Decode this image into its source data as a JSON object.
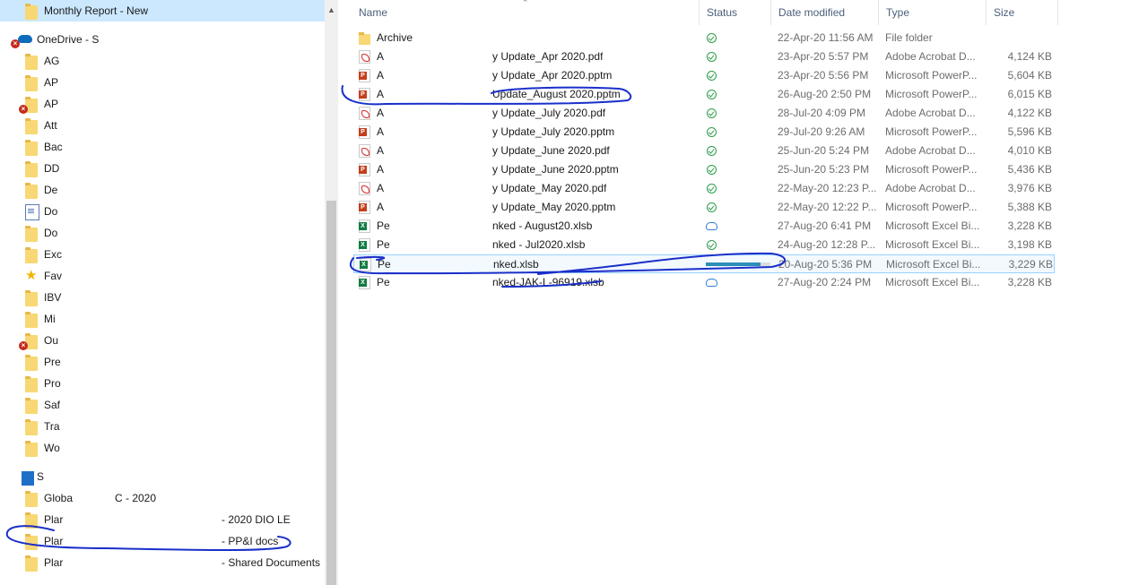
{
  "nav": {
    "items": [
      {
        "label": "Monthly Report - New",
        "icon": "folder-icon",
        "selected": true,
        "error": false,
        "extra": ""
      },
      {
        "label": "OneDrive - S",
        "icon": "onedrive-cloud-icon",
        "selected": false,
        "error": true,
        "extra": ""
      },
      {
        "label": "AG",
        "icon": "folder-icon",
        "error": false,
        "extra": ""
      },
      {
        "label": "AP",
        "icon": "folder-icon",
        "error": false,
        "extra": ""
      },
      {
        "label": "AP",
        "icon": "folder-icon",
        "error": true,
        "extra": ""
      },
      {
        "label": "Att",
        "icon": "folder-icon",
        "error": false,
        "extra": ""
      },
      {
        "label": "Bac",
        "icon": "folder-icon",
        "error": false,
        "extra": ""
      },
      {
        "label": "DD",
        "icon": "folder-icon",
        "error": false,
        "extra": ""
      },
      {
        "label": "De",
        "icon": "folder-icon",
        "error": false,
        "extra": ""
      },
      {
        "label": "Do",
        "icon": "document-icon",
        "error": false,
        "extra": ""
      },
      {
        "label": "Do",
        "icon": "folder-icon",
        "error": false,
        "extra": ""
      },
      {
        "label": "Exc",
        "icon": "folder-icon",
        "error": false,
        "extra": ""
      },
      {
        "label": "Fav",
        "icon": "star-icon",
        "error": false,
        "extra": ""
      },
      {
        "label": "IBV",
        "icon": "folder-icon",
        "error": false,
        "extra": ""
      },
      {
        "label": "Mi",
        "icon": "folder-icon",
        "error": false,
        "extra": ""
      },
      {
        "label": "Ou",
        "icon": "folder-icon",
        "error": true,
        "extra": ""
      },
      {
        "label": "Pre",
        "icon": "folder-icon",
        "error": false,
        "extra": ""
      },
      {
        "label": "Pro",
        "icon": "folder-icon",
        "error": false,
        "extra": ""
      },
      {
        "label": "Saf",
        "icon": "folder-icon",
        "error": false,
        "extra": ""
      },
      {
        "label": "Tra",
        "icon": "folder-icon",
        "error": false,
        "extra": ""
      },
      {
        "label": "Wo",
        "icon": "folder-icon",
        "error": false,
        "extra": ""
      },
      {
        "label": "S",
        "icon": "sharepoint-building-icon",
        "error": false,
        "extra": ""
      },
      {
        "label": "Globa",
        "icon": "folder-icon",
        "error": false,
        "extra": "C - 2020"
      },
      {
        "label": "Plar",
        "icon": "folder-icon",
        "error": false,
        "extra": "- 2020 DIO LE"
      },
      {
        "label": "Plar",
        "icon": "folder-icon",
        "error": false,
        "extra": "- PP&I docs"
      },
      {
        "label": "Plar",
        "icon": "folder-icon",
        "error": false,
        "extra": "- Shared Documents"
      }
    ]
  },
  "columns": {
    "name": "Name",
    "status": "Status",
    "date": "Date modified",
    "type": "Type",
    "size": "Size"
  },
  "files": [
    {
      "icon": "folder-icon",
      "lead": "Archive",
      "name": "",
      "status": "ok",
      "date": "22-Apr-20 11:56 AM",
      "type": "File folder",
      "size": ""
    },
    {
      "icon": "pdf-icon",
      "lead": "A",
      "name": "y Update_Apr 2020.pdf",
      "status": "ok",
      "date": "23-Apr-20 5:57 PM",
      "type": "Adobe Acrobat D...",
      "size": "4,124 KB"
    },
    {
      "icon": "powerpoint-icon",
      "lead": "A",
      "name": "y Update_Apr 2020.pptm",
      "status": "ok",
      "date": "23-Apr-20 5:56 PM",
      "type": "Microsoft PowerP...",
      "size": "5,604 KB"
    },
    {
      "icon": "powerpoint-icon",
      "lead": "A",
      "name": "Update_August 2020.pptm",
      "status": "ok",
      "date": "26-Aug-20 2:50 PM",
      "type": "Microsoft PowerP...",
      "size": "6,015 KB"
    },
    {
      "icon": "pdf-icon",
      "lead": "A",
      "name": "y Update_July 2020.pdf",
      "status": "ok",
      "date": "28-Jul-20 4:09 PM",
      "type": "Adobe Acrobat D...",
      "size": "4,122 KB"
    },
    {
      "icon": "powerpoint-icon",
      "lead": "A",
      "name": "y Update_July 2020.pptm",
      "status": "ok",
      "date": "29-Jul-20 9:26 AM",
      "type": "Microsoft PowerP...",
      "size": "5,596 KB"
    },
    {
      "icon": "pdf-icon",
      "lead": "A",
      "name": "y Update_June 2020.pdf",
      "status": "ok",
      "date": "25-Jun-20 5:24 PM",
      "type": "Adobe Acrobat D...",
      "size": "4,010 KB"
    },
    {
      "icon": "powerpoint-icon",
      "lead": "A",
      "name": "y Update_June 2020.pptm",
      "status": "ok",
      "date": "25-Jun-20 5:23 PM",
      "type": "Microsoft PowerP...",
      "size": "5,436 KB"
    },
    {
      "icon": "pdf-icon",
      "lead": "A",
      "name": "y Update_May 2020.pdf",
      "status": "ok",
      "date": "22-May-20 12:23 P...",
      "type": "Adobe Acrobat D...",
      "size": "3,976 KB"
    },
    {
      "icon": "powerpoint-icon",
      "lead": "A",
      "name": "y Update_May 2020.pptm",
      "status": "ok",
      "date": "22-May-20 12:22 P...",
      "type": "Microsoft PowerP...",
      "size": "5,388 KB"
    },
    {
      "icon": "excel-icon",
      "lead": "Pe",
      "name": "nked - August20.xlsb",
      "status": "cloud",
      "date": "27-Aug-20 6:41 PM",
      "type": "Microsoft Excel Bi...",
      "size": "3,228 KB"
    },
    {
      "icon": "excel-icon",
      "lead": "Pe",
      "name": "nked - Jul2020.xlsb",
      "status": "ok",
      "date": "24-Aug-20 12:28 P...",
      "type": "Microsoft Excel Bi...",
      "size": "3,198 KB"
    },
    {
      "icon": "excel-icon",
      "lead": "Pe",
      "name": "nked.xlsb",
      "status": "syncing",
      "progress": 0.85,
      "date": "20-Aug-20 5:36 PM",
      "type": "Microsoft Excel Bi...",
      "size": "3,229 KB"
    },
    {
      "icon": "excel-icon",
      "lead": "Pe",
      "name": "nked-JAK-L-96919.xlsb",
      "status": "cloud",
      "date": "27-Aug-20 2:24 PM",
      "type": "Microsoft Excel Bi...",
      "size": "3,228 KB"
    }
  ],
  "colors": {
    "selected_bg": "#cce8ff",
    "annotation": "#1a2fc9",
    "status_ok": "#2e9e4a",
    "status_cloud": "#2f7cd6"
  }
}
